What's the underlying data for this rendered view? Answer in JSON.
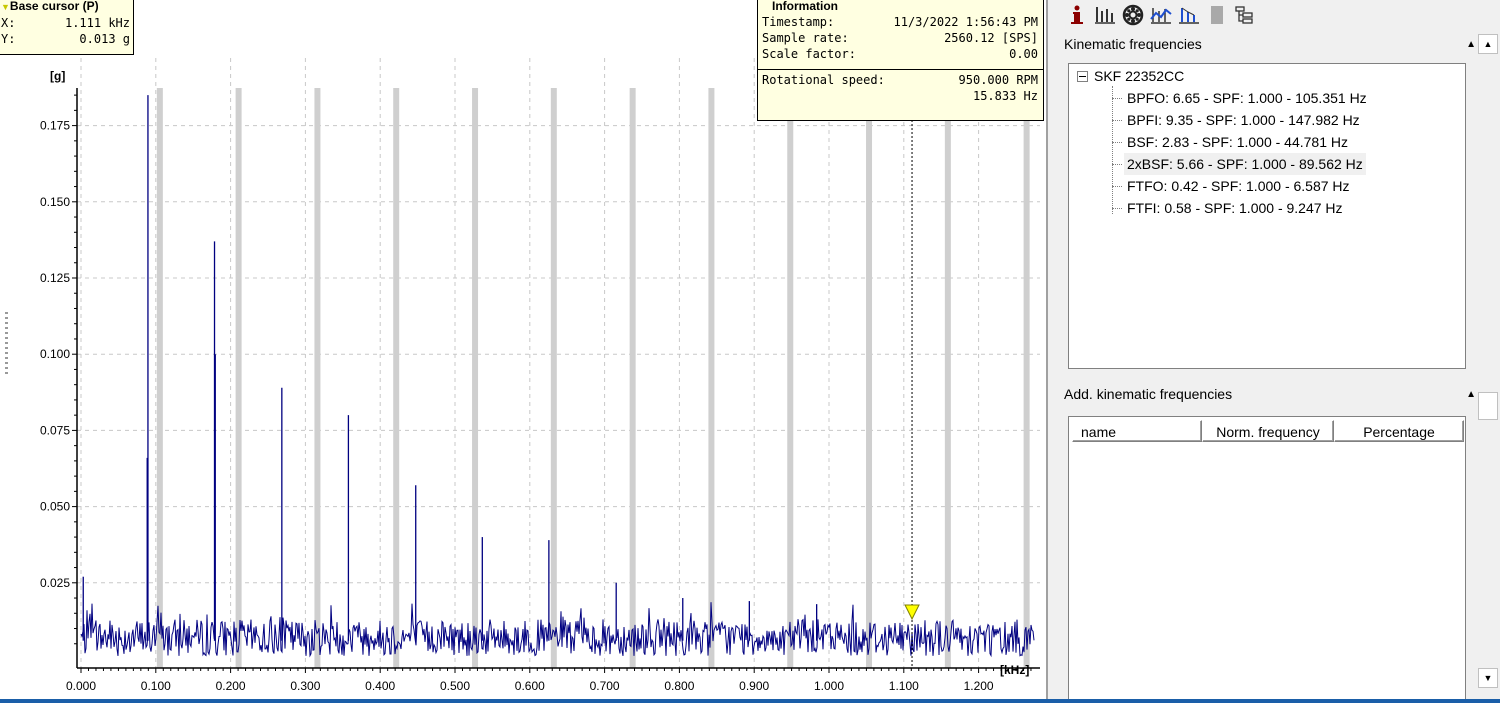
{
  "plot": {
    "y_unit": "[g]",
    "x_unit": "[kHz]",
    "y_ticks": [
      "0.175",
      "0.150",
      "0.125",
      "0.100",
      "0.075",
      "0.050",
      "0.025"
    ],
    "x_ticks": [
      "0.000",
      "0.100",
      "0.200",
      "0.300",
      "0.400",
      "0.500",
      "0.600",
      "0.700",
      "0.800",
      "0.900",
      "1.000",
      "1.100",
      "1.200"
    ]
  },
  "chart_data": {
    "type": "line",
    "xlabel": "[kHz]",
    "ylabel": "[g]",
    "xlim": [
      0,
      1.28
    ],
    "ylim": [
      0,
      0.19
    ],
    "grid": true,
    "series": [
      {
        "peaks": [
          {
            "x": 0.003,
            "y": 0.027
          },
          {
            "x": 0.0895,
            "y": 0.185
          },
          {
            "x": 0.0885,
            "y": 0.066
          },
          {
            "x": 0.1785,
            "y": 0.137
          },
          {
            "x": 0.1795,
            "y": 0.1
          },
          {
            "x": 0.2685,
            "y": 0.089
          },
          {
            "x": 0.3575,
            "y": 0.08
          },
          {
            "x": 0.4475,
            "y": 0.057
          },
          {
            "x": 0.5365,
            "y": 0.04
          },
          {
            "x": 0.6255,
            "y": 0.039
          },
          {
            "x": 0.7155,
            "y": 0.025
          },
          {
            "x": 0.8045,
            "y": 0.02
          },
          {
            "x": 0.8935,
            "y": 0.019
          },
          {
            "x": 0.9835,
            "y": 0.018
          }
        ],
        "noise_floor": 0.007,
        "color": "#000080"
      }
    ],
    "harmonic_markers_khz": [
      0.1054,
      0.2107,
      0.3161,
      0.4214,
      0.5268,
      0.6321,
      0.7375,
      0.8428,
      0.9482,
      1.0535,
      1.1589,
      1.2642
    ],
    "cursor_x": 1.111,
    "cursor_y": 0.013
  },
  "cursor": {
    "title": "Base cursor (P)",
    "x_label": "X:",
    "x_value": "1.111 kHz",
    "y_label": "Y:",
    "y_value": "0.013 g"
  },
  "info": {
    "title": "Information",
    "timestamp_label": "Timestamp:",
    "timestamp_value": "11/3/2022 1:56:43 PM",
    "sample_rate_label": "Sample rate:",
    "sample_rate_value": "2560.12 [SPS]",
    "scale_label": "Scale factor:",
    "scale_value": "0.00",
    "rot_label": "Rotational speed:",
    "rot_rpm": "950.000 RPM",
    "rot_hz": "15.833 Hz"
  },
  "right_panel": {
    "kin_title": "Kinematic frequencies",
    "tree_root": "SKF 22352CC",
    "tree_items": [
      "BPFO: 6.65 - SPF: 1.000 - 105.351 Hz",
      "BPFI: 9.35 - SPF: 1.000 - 147.982 Hz",
      "BSF: 2.83 - SPF: 1.000 - 44.781 Hz",
      "2xBSF: 5.66 - SPF: 1.000 - 89.562 Hz",
      "FTFO: 0.42 - SPF: 1.000 - 6.587 Hz",
      "FTFI: 0.58 - SPF: 1.000 - 9.247 Hz"
    ],
    "selected_index": 3,
    "add_title": "Add. kinematic frequencies",
    "columns": [
      "name",
      "Norm. frequency",
      "Percentage"
    ]
  },
  "icons": [
    "info-icon",
    "bars-icon",
    "bearing-icon",
    "trend-icon",
    "harmonics-icon",
    "gray-block-icon",
    "hierarchy-icon"
  ],
  "colors": {
    "trace": "#000080",
    "marker": "#c8c8c8",
    "tooltip_bg": "#ffffe1",
    "cursor_marker": "#ffff00",
    "bottom_strip": "#1a5ea8"
  }
}
